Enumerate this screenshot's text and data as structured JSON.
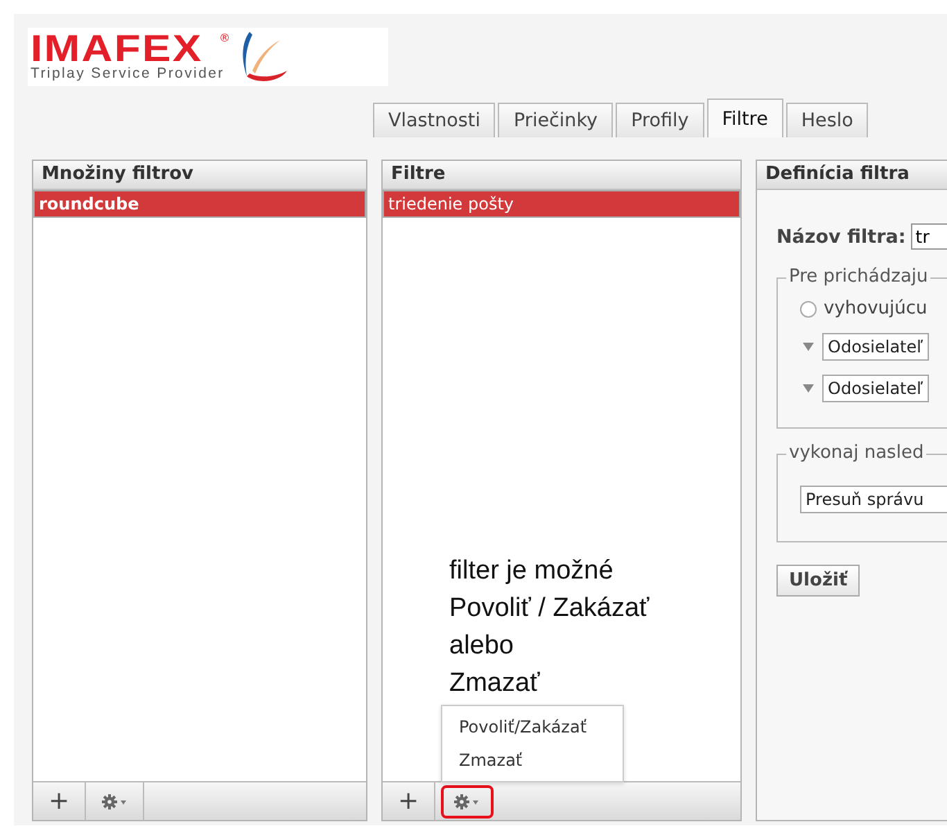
{
  "logo": {
    "name": "IMAFEX",
    "mark": "®",
    "tagline": "Triplay Service Provider"
  },
  "tabs": [
    {
      "label": "Vlastnosti",
      "selected": false
    },
    {
      "label": "Priečinky",
      "selected": false
    },
    {
      "label": "Profily",
      "selected": false
    },
    {
      "label": "Filtre",
      "selected": true
    },
    {
      "label": "Heslo",
      "selected": false
    }
  ],
  "filter_sets": {
    "title": "Množiny filtrov",
    "items": [
      {
        "label": "roundcube",
        "selected": true
      }
    ],
    "footer": {
      "add": "+",
      "gear_highlighted": false
    }
  },
  "filters": {
    "title": "Filtre",
    "items": [
      {
        "label": "triedenie pošty",
        "selected": true
      }
    ],
    "footer": {
      "add": "+",
      "gear_highlighted": true
    },
    "annotation": [
      "filter je možné",
      "Povoliť / Zakázať",
      "alebo",
      "Zmazať"
    ],
    "menu": [
      "Povoliť/Zakázať",
      "Zmazať"
    ]
  },
  "definition": {
    "title": "Definícia filtra",
    "name_label": "Názov filtra:",
    "name_value": "tr",
    "incoming_legend": "Pre prichádzaju",
    "radio_label": "vyhovujúcu",
    "radio_checked": false,
    "rules": [
      "Odosielateľ",
      "Odosielateľ"
    ],
    "actions_legend": "vykonaj nasled",
    "action": "Presuň správu",
    "save": "Uložiť"
  }
}
